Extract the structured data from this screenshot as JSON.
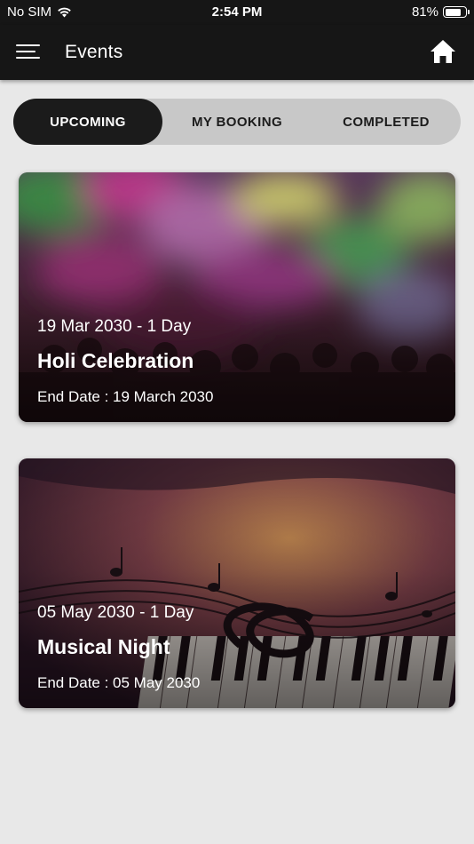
{
  "status_bar": {
    "carrier": "No SIM",
    "time": "2:54 PM",
    "battery_percent": "81%",
    "battery_level": 0.81,
    "wifi_icon": "wifi-icon",
    "battery_icon": "battery-icon"
  },
  "appbar": {
    "title": "Events",
    "menu_icon": "hamburger-menu-icon",
    "home_icon": "home-icon"
  },
  "tabs": [
    {
      "label": "UPCOMING",
      "active": true
    },
    {
      "label": "MY BOOKING",
      "active": false
    },
    {
      "label": "COMPLETED",
      "active": false
    }
  ],
  "events": [
    {
      "date_line": "19 Mar 2030 - 1 Day",
      "title": "Holi Celebration",
      "end_date": "End Date : 19 March 2030"
    },
    {
      "date_line": "05 May 2030 - 1 Day",
      "title": "Musical Night",
      "end_date": "End Date : 05 May 2030"
    }
  ],
  "colors": {
    "header_bg": "#161616",
    "page_bg": "#e8e8e8",
    "tab_track": "#c8c8c8",
    "tab_active": "#1b1b1b"
  }
}
